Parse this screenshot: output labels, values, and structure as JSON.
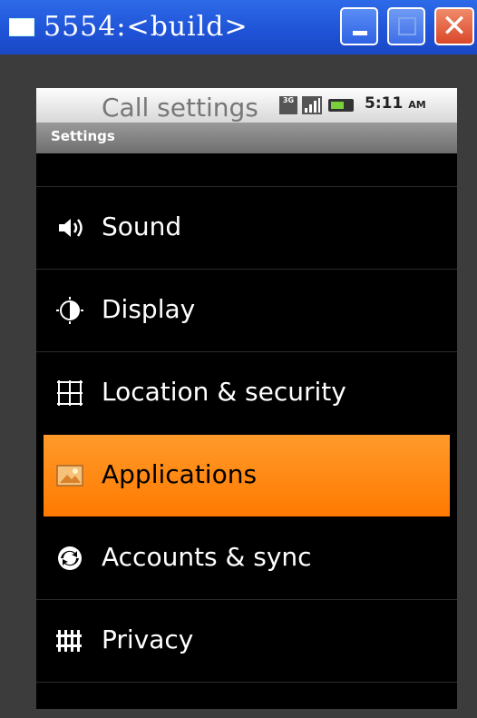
{
  "window": {
    "title": "5554:<build>"
  },
  "statusbar": {
    "network": "3G",
    "time": "5:11",
    "ampm": "AM"
  },
  "appbar": {
    "title": "Settings"
  },
  "settings": {
    "items": [
      {
        "label": "Call settings",
        "icon": "call-icon"
      },
      {
        "label": "Sound",
        "icon": "speaker-icon"
      },
      {
        "label": "Display",
        "icon": "display-icon"
      },
      {
        "label": "Location & security",
        "icon": "location-grid-icon"
      },
      {
        "label": "Applications",
        "icon": "applications-icon",
        "selected": true
      },
      {
        "label": "Accounts & sync",
        "icon": "sync-icon"
      },
      {
        "label": "Privacy",
        "icon": "privacy-icon"
      }
    ]
  },
  "colors": {
    "selection": "#ff8a10",
    "titlebar": "#1f52d6"
  }
}
